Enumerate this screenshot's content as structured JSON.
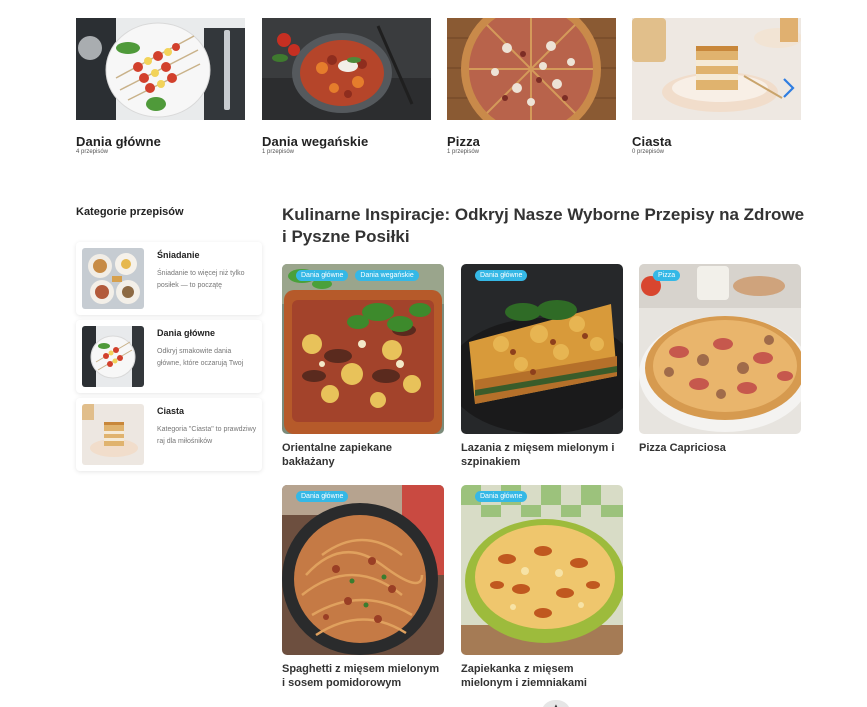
{
  "categories": [
    {
      "name": "Dania główne",
      "count": "4 przepisów"
    },
    {
      "name": "Dania wegańskie",
      "count": "1 przepisów"
    },
    {
      "name": "Pizza",
      "count": "1 przepisów"
    },
    {
      "name": "Ciasta",
      "count": "0 przepisów"
    }
  ],
  "sidebar": {
    "title": "Kategorie przepisów",
    "items": [
      {
        "title": "Śniadanie",
        "desc": "Śniadanie to więcej niż tylko posiłek — to początę"
      },
      {
        "title": "Dania główne",
        "desc": "Odkryj smakowite dania główne, które oczarują Twoj"
      },
      {
        "title": "Ciasta",
        "desc": "Kategoria \"Ciasta\" to prawdziwy raj dla miłośników"
      }
    ]
  },
  "main": {
    "title": "Kulinarne Inspiracje: Odkryj Nasze Wyborne Przepisy na Zdrowe i Pyszne Posiłki",
    "recipes": [
      {
        "name": "Orientalne zapiekane bakłażany",
        "badges": [
          "Dania główne",
          "Dania wegańskie"
        ]
      },
      {
        "name": "Lazania z mięsem mielonym i szpinakiem",
        "badges": [
          "Dania główne"
        ]
      },
      {
        "name": "Pizza Capriciosa",
        "badges": [
          "Pizza"
        ]
      },
      {
        "name": "Spaghetti z mięsem mielonym i sosem pomidorowym",
        "badges": [
          "Dania główne"
        ]
      },
      {
        "name": "Zapiekanka z mięsem mielonym i ziemniakami",
        "badges": [
          "Dania główne"
        ]
      }
    ]
  },
  "icons": {
    "carousel_next": "chevron-right-icon",
    "scroll_top": "chevron-up-icon"
  },
  "colors": {
    "badge": "#35b8e6",
    "chevron": "#2f7de1"
  }
}
